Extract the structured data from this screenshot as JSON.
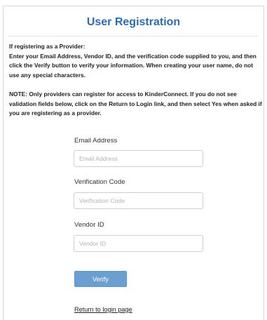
{
  "title": "User Registration",
  "instructions": {
    "heading": "If registering as a Provider:",
    "body": "Enter your Email Address, Vendor ID, and the verification code supplied to you, and then click the Verify button to verify your information. When creating your user name, do not use any special characters.",
    "note": "NOTE: Only providers can register for access to KinderConnect. If you do not see validation fields below, click on the Return to Login link, and then select Yes when asked if you are registering as a provider."
  },
  "form": {
    "email": {
      "label": "Email Address",
      "placeholder": "Email Address",
      "value": ""
    },
    "verification": {
      "label": "Verification Code",
      "placeholder": "Verification Code",
      "value": ""
    },
    "vendor": {
      "label": "Vendor ID",
      "placeholder": "Vendor ID",
      "value": ""
    },
    "verify_label": "Verify",
    "return_link": "Return to login page"
  },
  "colors": {
    "title": "#2e6cae",
    "button": "#6b9fd1"
  }
}
